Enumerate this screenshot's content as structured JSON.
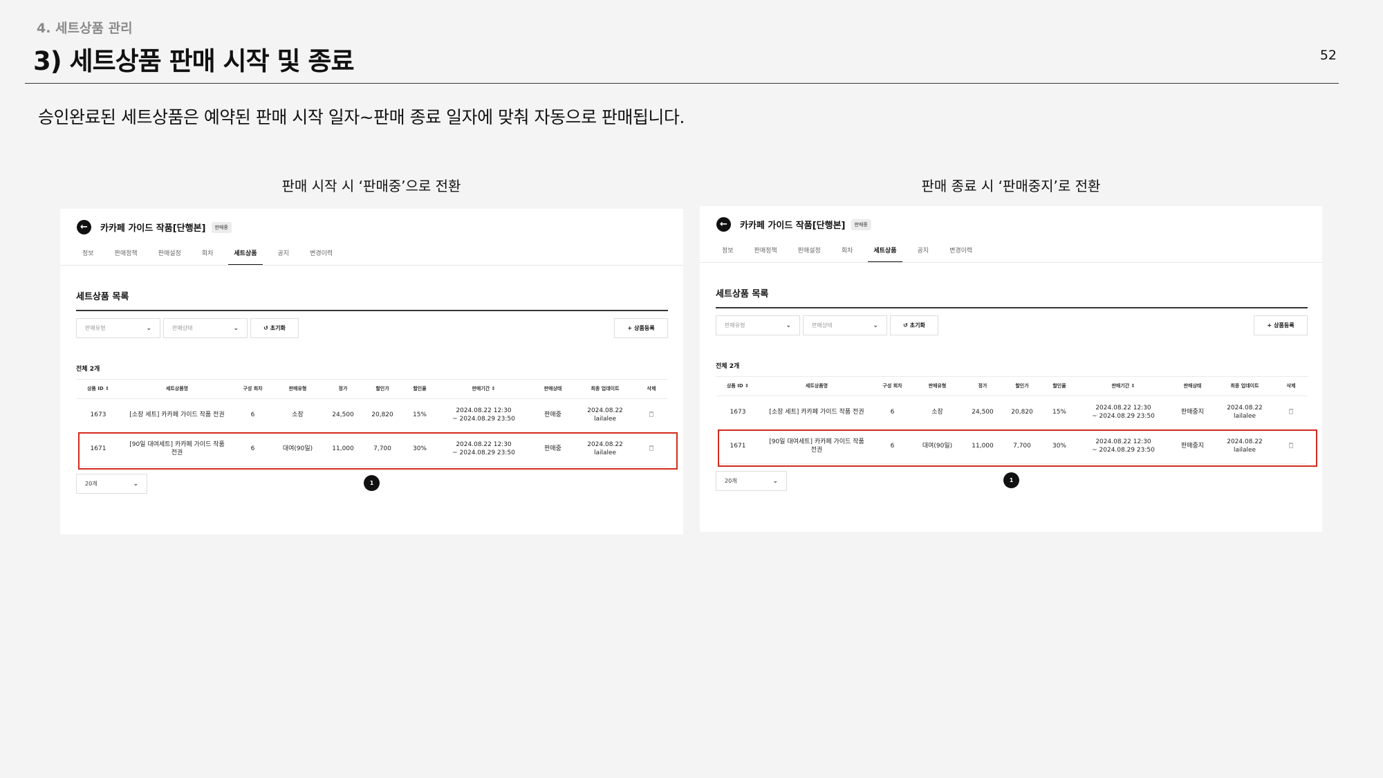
{
  "slide": {
    "section": "4. 세트상품 관리",
    "title": "3) 세트상품 판매 시작 및 종료",
    "page_number": "52",
    "description": "승인완료된 세트상품은 예약된 판매 시작 일자~판매 종료 일자에 맞춰 자동으로 판매됩니다."
  },
  "captions": {
    "left": "판매 시작 시 ‘판매중’으로 전환",
    "right": "판매 종료 시 ‘판매중지’로 전환"
  },
  "product": {
    "title": "카카페 가이드 작품[단행본]",
    "badge": "판매중"
  },
  "tabs": [
    "정보",
    "판매정책",
    "판매설정",
    "회차",
    "세트상품",
    "공지",
    "변경이력"
  ],
  "list": {
    "title": "세트상품 목록",
    "filter_type_placeholder": "판매유형",
    "filter_status_placeholder": "판매상태",
    "reset_label": "초기화",
    "add_label": "상품등록",
    "total_label": "전체 2개",
    "page_size": "20개",
    "current_page": "1"
  },
  "table": {
    "headers": [
      "상품 ID",
      "세트상품명",
      "구성 회차",
      "판매유형",
      "정가",
      "할인가",
      "할인율",
      "판매기간",
      "판매상태",
      "최종 업데이트",
      "삭제"
    ],
    "rows": [
      {
        "id": "1673",
        "name": "[소장 세트] 카카페 가이드 작품 전권",
        "episodes": "6",
        "type": "소장",
        "price": "24,500",
        "sale_price": "20,820",
        "rate": "15%",
        "period_start": "2024.08.22 12:30",
        "period_end": "~ 2024.08.29 23:50",
        "updated_date": "2024.08.22",
        "updated_by": "lailalee"
      },
      {
        "id": "1671",
        "name_line1": "[90일 대여세트] 카카페 가이드 작품",
        "name_line2": "전권",
        "episodes": "6",
        "type": "대여(90일)",
        "price": "11,000",
        "sale_price": "7,700",
        "rate": "30%",
        "period_start": "2024.08.22 12:30",
        "period_end": "~ 2024.08.29 23:50",
        "updated_date": "2024.08.22",
        "updated_by": "lailalee"
      }
    ]
  },
  "status": {
    "left": "판매중",
    "right": "판매중지"
  },
  "colors": {
    "highlight": "#d42a1d",
    "background": "#f4f4f4"
  },
  "icons": {
    "back": "arrow-left-icon",
    "sort": "sort-icon",
    "chevron": "chevron-down-icon",
    "reset": "refresh-icon",
    "add": "plus-icon",
    "delete": "trash-icon"
  }
}
